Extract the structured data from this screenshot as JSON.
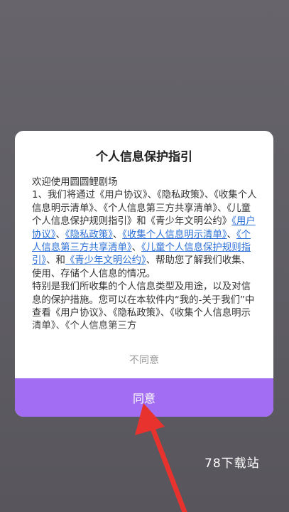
{
  "dialog": {
    "title": "个人信息保护指引",
    "greeting": "欢迎使用圆圆鲤剧场",
    "para1_intro": "1、我们将通过《用户协议》、《隐私政策》、《收集个人信息明示清单》、《个人信息第三方共享清单》、《儿童个人信息保护规则指引》和《青少年文明公约》",
    "links": [
      "《用户协议》",
      "《隐私政策》",
      "《收集个人信息明示清单》",
      "《个人信息第三方共享清单》",
      "《儿童个人信息保护规则指引》",
      "《青少年文明公约》"
    ],
    "sep": "、",
    "and": "和",
    "para1_outro": "帮助您了解我们收集、使用、存储个人信息的情况。",
    "para2": "特别是我们所收集的个人信息类型及用途，以及对信息的保护措施。您可以在本软件内“我的-关于我们”中查看《用户协议》、《隐私政策》、《收集个人信息明示清单》、《个人信息第三方",
    "disagree_label": "不同意",
    "agree_label": "同意"
  },
  "watermark": "78下载站",
  "colors": {
    "accent": "#a26df2",
    "link": "#2b6fd6",
    "arrow": "#e8322e"
  }
}
